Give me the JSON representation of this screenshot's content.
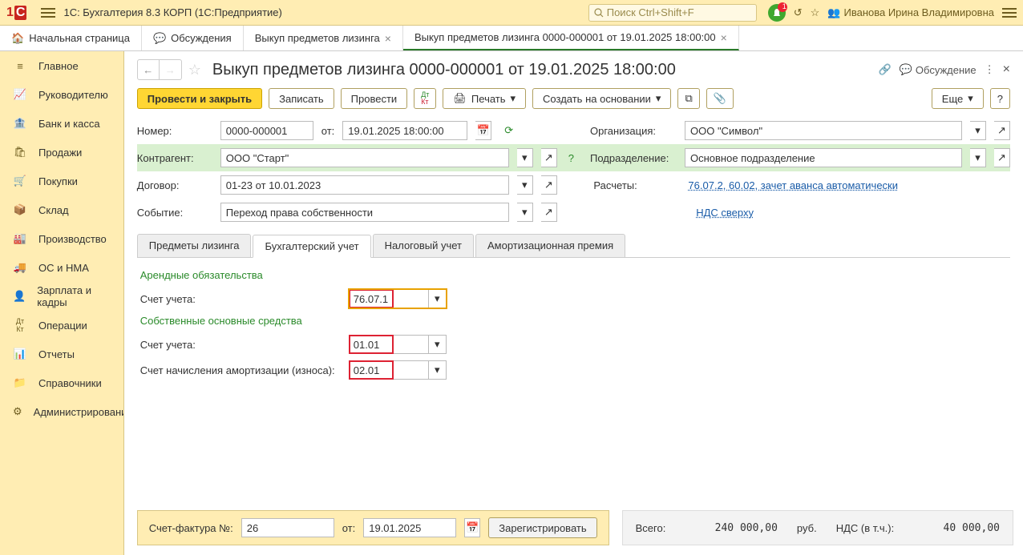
{
  "topbar": {
    "app_title": "1С: Бухгалтерия 8.3 КОРП  (1С:Предприятие)",
    "search_placeholder": "Поиск Ctrl+Shift+F",
    "notif_count": "1",
    "user_name": "Иванова Ирина Владимировна"
  },
  "tabs": [
    {
      "label": "Начальная страница",
      "icon": "home"
    },
    {
      "label": "Обсуждения",
      "icon": "discuss"
    },
    {
      "label": "Выкуп предметов лизинга",
      "closable": true
    },
    {
      "label": "Выкуп предметов лизинга 0000-000001 от 19.01.2025 18:00:00",
      "closable": true,
      "active": true
    }
  ],
  "sidebar": [
    "Главное",
    "Руководителю",
    "Банк и касса",
    "Продажи",
    "Покупки",
    "Склад",
    "Производство",
    "ОС и НМА",
    "Зарплата и кадры",
    "Операции",
    "Отчеты",
    "Справочники",
    "Администрирование"
  ],
  "doc": {
    "title": "Выкуп предметов лизинга 0000-000001 от 19.01.2025 18:00:00",
    "discuss_label": "Обсуждение"
  },
  "toolbar": {
    "post_close": "Провести и закрыть",
    "save": "Записать",
    "post": "Провести",
    "print": "Печать",
    "create_based": "Создать на основании",
    "more": "Еще",
    "help": "?"
  },
  "form": {
    "number_label": "Номер:",
    "number": "0000-000001",
    "from_label": "от:",
    "date": "19.01.2025 18:00:00",
    "org_label": "Организация:",
    "org": "ООО \"Символ\"",
    "counterparty_label": "Контрагент:",
    "counterparty": "ООО \"Старт\"",
    "division_label": "Подразделение:",
    "division": "Основное подразделение",
    "contract_label": "Договор:",
    "contract": "01-23 от 10.01.2023",
    "settlements_label": "Расчеты:",
    "settlements": "76.07.2, 60.02, зачет аванса автоматически",
    "event_label": "Событие:",
    "event": "Переход права собственности",
    "vat_link": "НДС сверху"
  },
  "subtabs": [
    "Предметы лизинга",
    "Бухгалтерский учет",
    "Налоговый учет",
    "Амортизационная премия"
  ],
  "subtab_active": 1,
  "accounting": {
    "section1": "Арендные обязательства",
    "account1_label": "Счет учета:",
    "account1": "76.07.1",
    "section2": "Собственные основные средства",
    "account2_label": "Счет учета:",
    "account2": "01.01",
    "amort_label": "Счет начисления амортизации (износа):",
    "amort": "02.01"
  },
  "invoice": {
    "label": "Счет-фактура №:",
    "number": "26",
    "from": "от:",
    "date": "19.01.2025",
    "register": "Зарегистрировать"
  },
  "totals": {
    "total_label": "Всего:",
    "total": "240 000,00",
    "currency": "руб.",
    "vat_label": "НДС (в т.ч.):",
    "vat": "40 000,00"
  }
}
